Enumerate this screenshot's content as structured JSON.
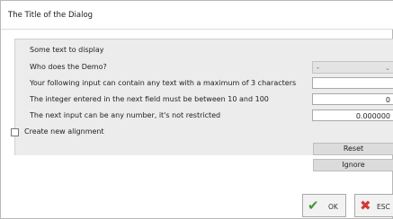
{
  "dialog": {
    "title": "The Title of the Dialog"
  },
  "form": {
    "intro_text": "Some text to display",
    "demo_label": "Who does the Demo?",
    "demo_select": {
      "value": "-",
      "chevron_icon": "chevron-down-icon"
    },
    "text_label": "Your following input can contain any text with a maximum of 3 characters",
    "text_value": "",
    "integer_label": "The integer entered in the next field must be between 10 and 100",
    "integer_value": "0",
    "number_label": "The next input can be any number, it's not restricted",
    "number_value": "0.000000",
    "checkbox_label": "Create new alignment",
    "checkbox_checked": false
  },
  "side_buttons": {
    "reset": "Reset",
    "ignore": "Ignore"
  },
  "footer": {
    "ok": {
      "label": "OK",
      "icon": "checkmark-icon",
      "color": "#3c9a2e"
    },
    "esc": {
      "label": "ESC",
      "icon": "close-icon",
      "color": "#d23a3a"
    }
  }
}
